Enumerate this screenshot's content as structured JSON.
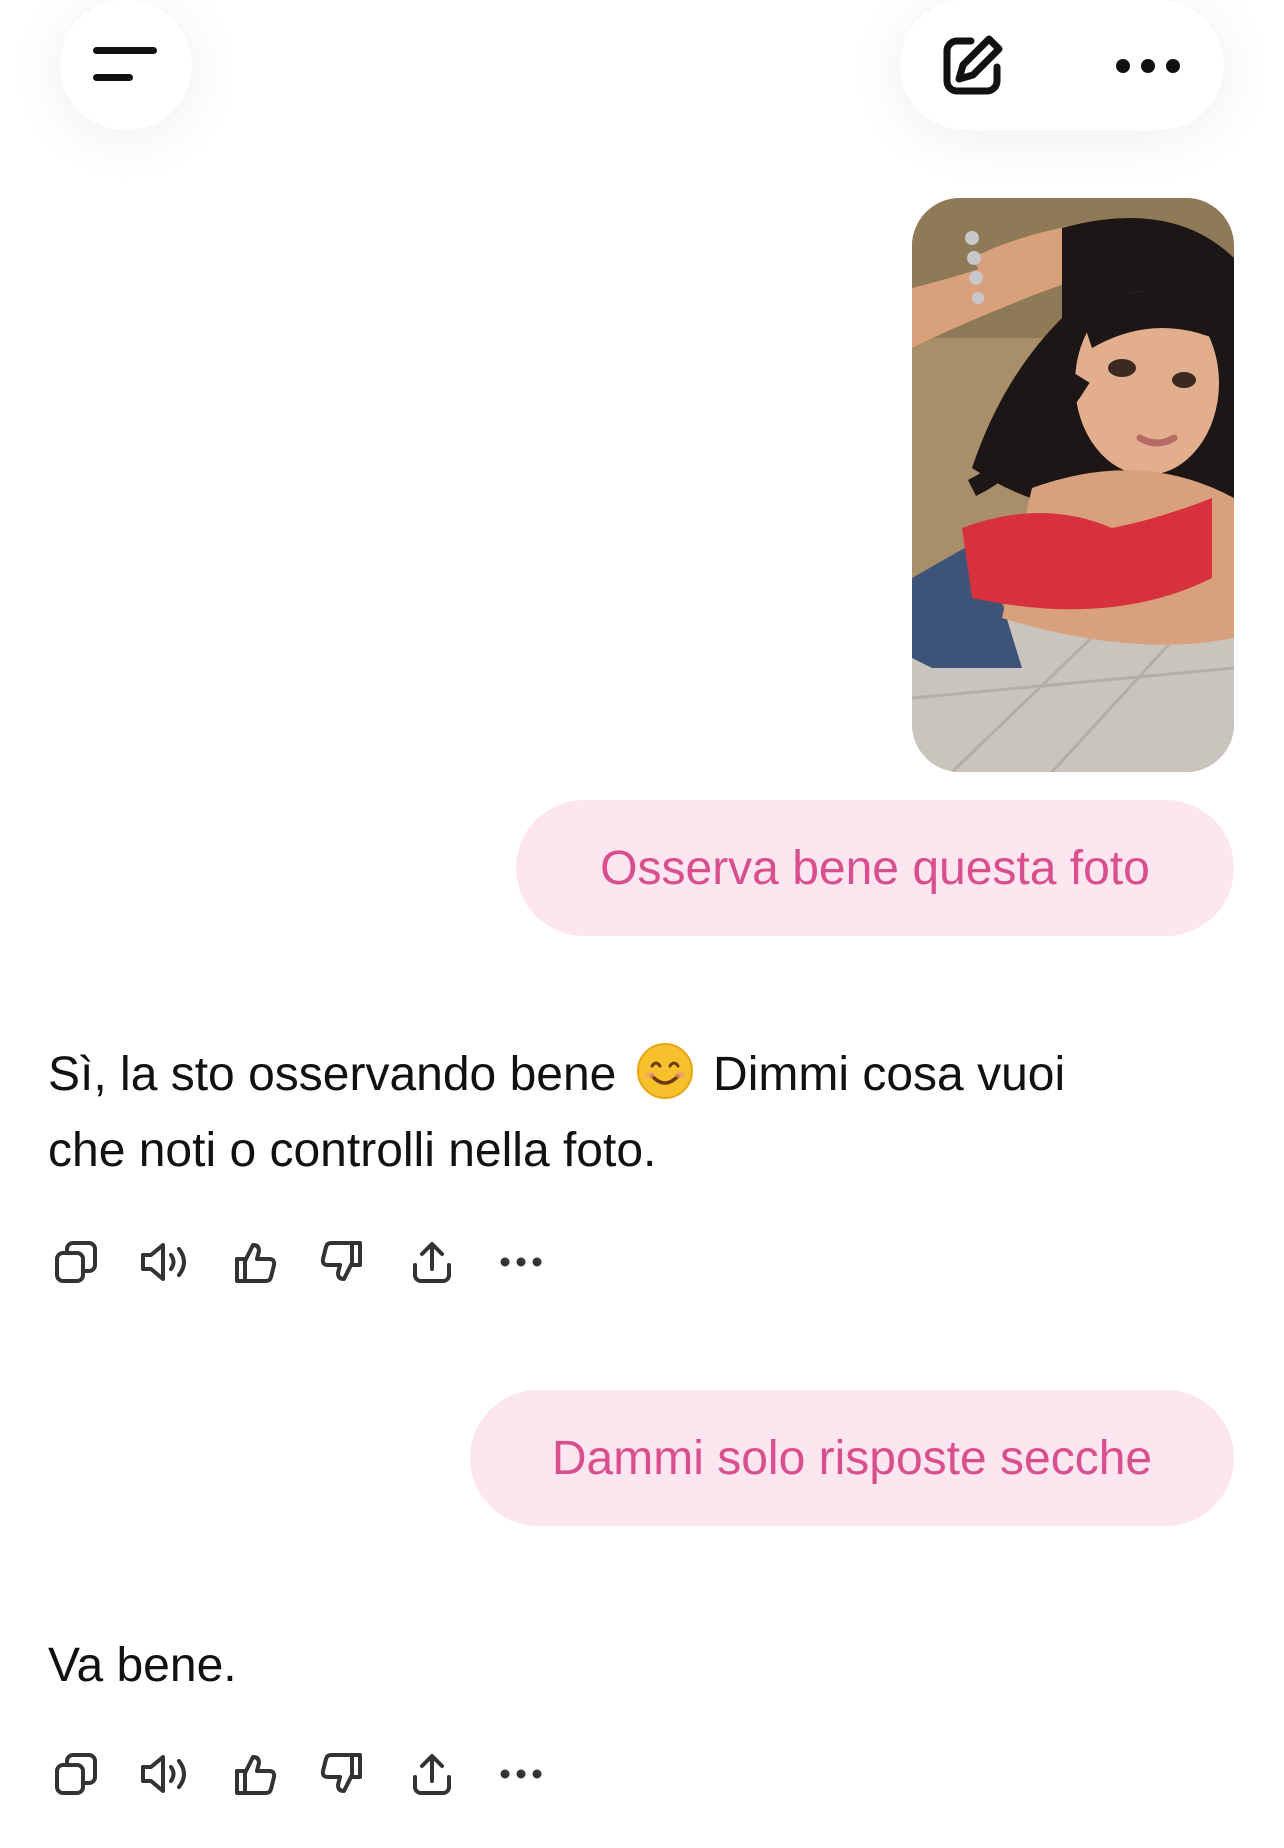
{
  "header": {
    "menu_icon": "menu-icon",
    "edit_icon": "compose-icon",
    "more_icon": "more-icon"
  },
  "colors": {
    "bubble_bg": "#fde6ef",
    "bubble_text": "#d94f8d",
    "text": "#111111"
  },
  "messages": [
    {
      "role": "user",
      "attachment": "photo",
      "text": "Osserva bene questa foto"
    },
    {
      "role": "assistant",
      "line1_before_emoji": "Sì, la sto osservando bene",
      "emoji": "smiling-face-icon",
      "line1_after_emoji": "Dimmi cosa vuoi",
      "line2": "che noti o controlli nella foto."
    },
    {
      "role": "user",
      "text": "Dammi solo risposte secche"
    },
    {
      "role": "assistant",
      "text": "Va bene."
    }
  ],
  "message_actions": [
    "copy-icon",
    "read-aloud-icon",
    "thumbs-up-icon",
    "thumbs-down-icon",
    "share-icon",
    "more-icon"
  ]
}
